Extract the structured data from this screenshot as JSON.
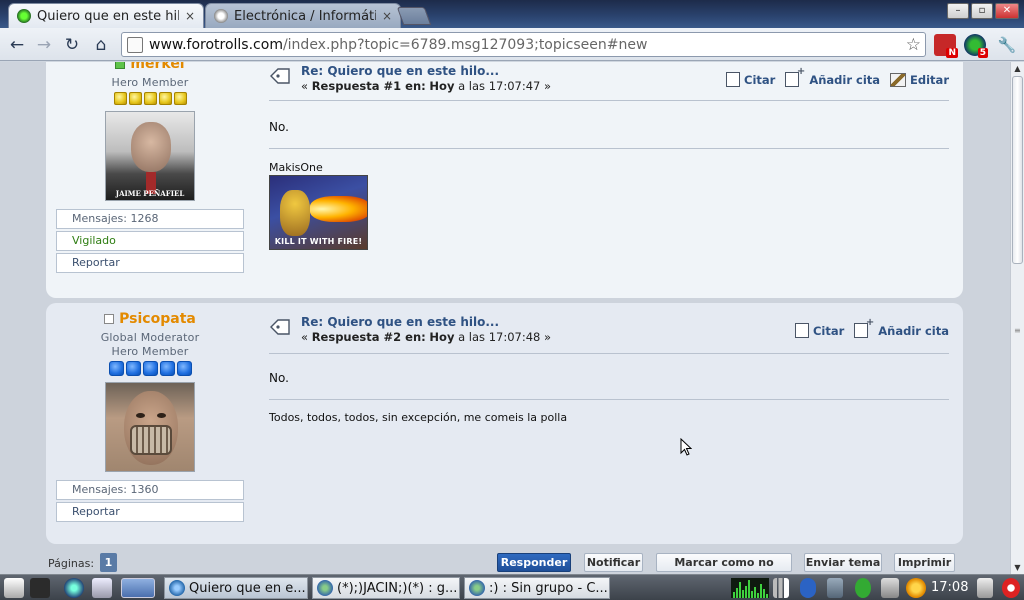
{
  "tabs": [
    {
      "title": "Quiero que en este hilo",
      "close": "×",
      "active": true
    },
    {
      "title": "Electrónica / Informátic",
      "close": "×",
      "active": false
    }
  ],
  "window_controls": {
    "minimize": "–",
    "maximize": "▫",
    "close": "✕"
  },
  "toolbar": {
    "url_host": "www.forotrolls.com",
    "url_rest": "/index.php?topic=6789.msg127093;topicseen#new",
    "ext_badge_1": "N",
    "ext_badge_2": "5"
  },
  "posts": [
    {
      "username": "merkel",
      "online": true,
      "ranks": [
        "Hero Member"
      ],
      "star_count": 5,
      "star_color": "gold",
      "avatar_caption": "JAIME PEÑAFIEL",
      "stats": [
        "Mensajes: 1268",
        "Vigilado",
        "Reportar"
      ],
      "subject": "Re: Quiero que en este hilo...",
      "meta_prefix": "«",
      "meta_reply": "Respuesta #1 en:",
      "meta_day": "Hoy",
      "meta_time": "a las 17:07:47 »",
      "actions": [
        "Citar",
        "Añadir cita",
        "Editar"
      ],
      "message": "No.",
      "signature_name": "MakisOne",
      "signature_img_text": "KILL IT WITH FIRE!"
    },
    {
      "username": "Psicopata",
      "online": false,
      "ranks": [
        "Global Moderator",
        "Hero Member"
      ],
      "star_count": 5,
      "star_color": "blue",
      "stats": [
        "Mensajes: 1360",
        "Reportar"
      ],
      "subject": "Re: Quiero que en este hilo...",
      "meta_prefix": "«",
      "meta_reply": "Respuesta #2 en:",
      "meta_day": "Hoy",
      "meta_time": "a las 17:07:48 »",
      "actions": [
        "Citar",
        "Añadir cita"
      ],
      "message": "No.",
      "signature_text": "Todos, todos, todos, sin excepción, me comeis la polla"
    }
  ],
  "pagination": {
    "label": "Páginas:",
    "current": "1",
    "buttons": [
      "Responder",
      "Notificar",
      "Marcar como no leídos",
      "Enviar tema",
      "Imprimir"
    ]
  },
  "taskbar": {
    "tasks": [
      "Quiero que en e...",
      "(*);)JACIN;)(*) : g...",
      ":) : Sin grupo - C..."
    ],
    "clock": "17:08"
  },
  "colors": {
    "accent_link": "#2f5283",
    "username": "#e38a00",
    "primary_button": "#1f4f98"
  }
}
